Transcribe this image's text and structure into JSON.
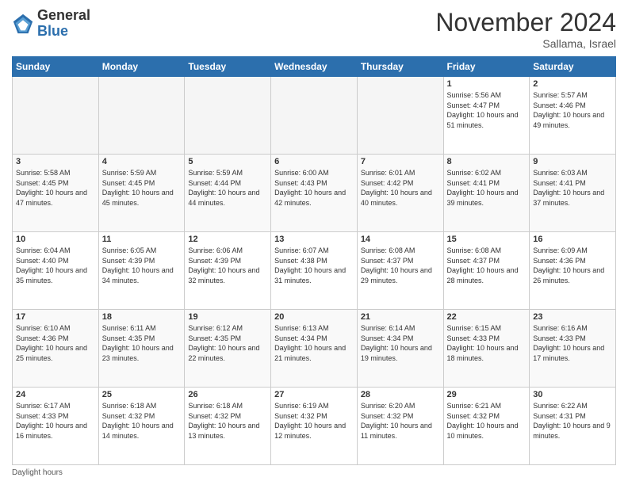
{
  "logo": {
    "general": "General",
    "blue": "Blue"
  },
  "header": {
    "month": "November 2024",
    "location": "Sallama, Israel"
  },
  "days_of_week": [
    "Sunday",
    "Monday",
    "Tuesday",
    "Wednesday",
    "Thursday",
    "Friday",
    "Saturday"
  ],
  "weeks": [
    [
      {
        "day": "",
        "info": ""
      },
      {
        "day": "",
        "info": ""
      },
      {
        "day": "",
        "info": ""
      },
      {
        "day": "",
        "info": ""
      },
      {
        "day": "",
        "info": ""
      },
      {
        "day": "1",
        "info": "Sunrise: 5:56 AM\nSunset: 4:47 PM\nDaylight: 10 hours\nand 51 minutes."
      },
      {
        "day": "2",
        "info": "Sunrise: 5:57 AM\nSunset: 4:46 PM\nDaylight: 10 hours\nand 49 minutes."
      }
    ],
    [
      {
        "day": "3",
        "info": "Sunrise: 5:58 AM\nSunset: 4:45 PM\nDaylight: 10 hours\nand 47 minutes."
      },
      {
        "day": "4",
        "info": "Sunrise: 5:59 AM\nSunset: 4:45 PM\nDaylight: 10 hours\nand 45 minutes."
      },
      {
        "day": "5",
        "info": "Sunrise: 5:59 AM\nSunset: 4:44 PM\nDaylight: 10 hours\nand 44 minutes."
      },
      {
        "day": "6",
        "info": "Sunrise: 6:00 AM\nSunset: 4:43 PM\nDaylight: 10 hours\nand 42 minutes."
      },
      {
        "day": "7",
        "info": "Sunrise: 6:01 AM\nSunset: 4:42 PM\nDaylight: 10 hours\nand 40 minutes."
      },
      {
        "day": "8",
        "info": "Sunrise: 6:02 AM\nSunset: 4:41 PM\nDaylight: 10 hours\nand 39 minutes."
      },
      {
        "day": "9",
        "info": "Sunrise: 6:03 AM\nSunset: 4:41 PM\nDaylight: 10 hours\nand 37 minutes."
      }
    ],
    [
      {
        "day": "10",
        "info": "Sunrise: 6:04 AM\nSunset: 4:40 PM\nDaylight: 10 hours\nand 35 minutes."
      },
      {
        "day": "11",
        "info": "Sunrise: 6:05 AM\nSunset: 4:39 PM\nDaylight: 10 hours\nand 34 minutes."
      },
      {
        "day": "12",
        "info": "Sunrise: 6:06 AM\nSunset: 4:39 PM\nDaylight: 10 hours\nand 32 minutes."
      },
      {
        "day": "13",
        "info": "Sunrise: 6:07 AM\nSunset: 4:38 PM\nDaylight: 10 hours\nand 31 minutes."
      },
      {
        "day": "14",
        "info": "Sunrise: 6:08 AM\nSunset: 4:37 PM\nDaylight: 10 hours\nand 29 minutes."
      },
      {
        "day": "15",
        "info": "Sunrise: 6:08 AM\nSunset: 4:37 PM\nDaylight: 10 hours\nand 28 minutes."
      },
      {
        "day": "16",
        "info": "Sunrise: 6:09 AM\nSunset: 4:36 PM\nDaylight: 10 hours\nand 26 minutes."
      }
    ],
    [
      {
        "day": "17",
        "info": "Sunrise: 6:10 AM\nSunset: 4:36 PM\nDaylight: 10 hours\nand 25 minutes."
      },
      {
        "day": "18",
        "info": "Sunrise: 6:11 AM\nSunset: 4:35 PM\nDaylight: 10 hours\nand 23 minutes."
      },
      {
        "day": "19",
        "info": "Sunrise: 6:12 AM\nSunset: 4:35 PM\nDaylight: 10 hours\nand 22 minutes."
      },
      {
        "day": "20",
        "info": "Sunrise: 6:13 AM\nSunset: 4:34 PM\nDaylight: 10 hours\nand 21 minutes."
      },
      {
        "day": "21",
        "info": "Sunrise: 6:14 AM\nSunset: 4:34 PM\nDaylight: 10 hours\nand 19 minutes."
      },
      {
        "day": "22",
        "info": "Sunrise: 6:15 AM\nSunset: 4:33 PM\nDaylight: 10 hours\nand 18 minutes."
      },
      {
        "day": "23",
        "info": "Sunrise: 6:16 AM\nSunset: 4:33 PM\nDaylight: 10 hours\nand 17 minutes."
      }
    ],
    [
      {
        "day": "24",
        "info": "Sunrise: 6:17 AM\nSunset: 4:33 PM\nDaylight: 10 hours\nand 16 minutes."
      },
      {
        "day": "25",
        "info": "Sunrise: 6:18 AM\nSunset: 4:32 PM\nDaylight: 10 hours\nand 14 minutes."
      },
      {
        "day": "26",
        "info": "Sunrise: 6:18 AM\nSunset: 4:32 PM\nDaylight: 10 hours\nand 13 minutes."
      },
      {
        "day": "27",
        "info": "Sunrise: 6:19 AM\nSunset: 4:32 PM\nDaylight: 10 hours\nand 12 minutes."
      },
      {
        "day": "28",
        "info": "Sunrise: 6:20 AM\nSunset: 4:32 PM\nDaylight: 10 hours\nand 11 minutes."
      },
      {
        "day": "29",
        "info": "Sunrise: 6:21 AM\nSunset: 4:32 PM\nDaylight: 10 hours\nand 10 minutes."
      },
      {
        "day": "30",
        "info": "Sunrise: 6:22 AM\nSunset: 4:31 PM\nDaylight: 10 hours\nand 9 minutes."
      }
    ]
  ],
  "footer": {
    "note": "Daylight hours"
  }
}
